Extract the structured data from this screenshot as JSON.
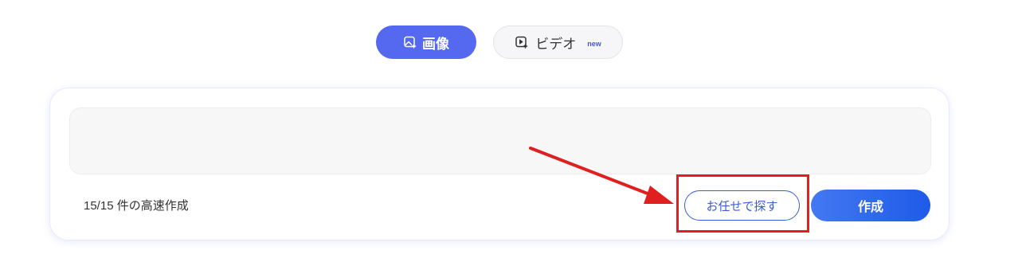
{
  "tabs": {
    "image": {
      "label": "画像",
      "icon": "image-sparkle-icon",
      "active": true
    },
    "video": {
      "label": "ビデオ",
      "badge": "new",
      "icon": "video-sparkle-icon",
      "active": false
    }
  },
  "prompt": {
    "value": "",
    "placeholder": ""
  },
  "footer": {
    "quota_text": "15/15 件の高速作成",
    "suggest_label": "お任せで探す",
    "create_label": "作成"
  },
  "annotation": {
    "color": "#e02020",
    "target": "suggest-button"
  },
  "colors": {
    "accent": "#5468f0",
    "create_button": "#2962ea",
    "suggest_border": "#3a5bd9"
  }
}
